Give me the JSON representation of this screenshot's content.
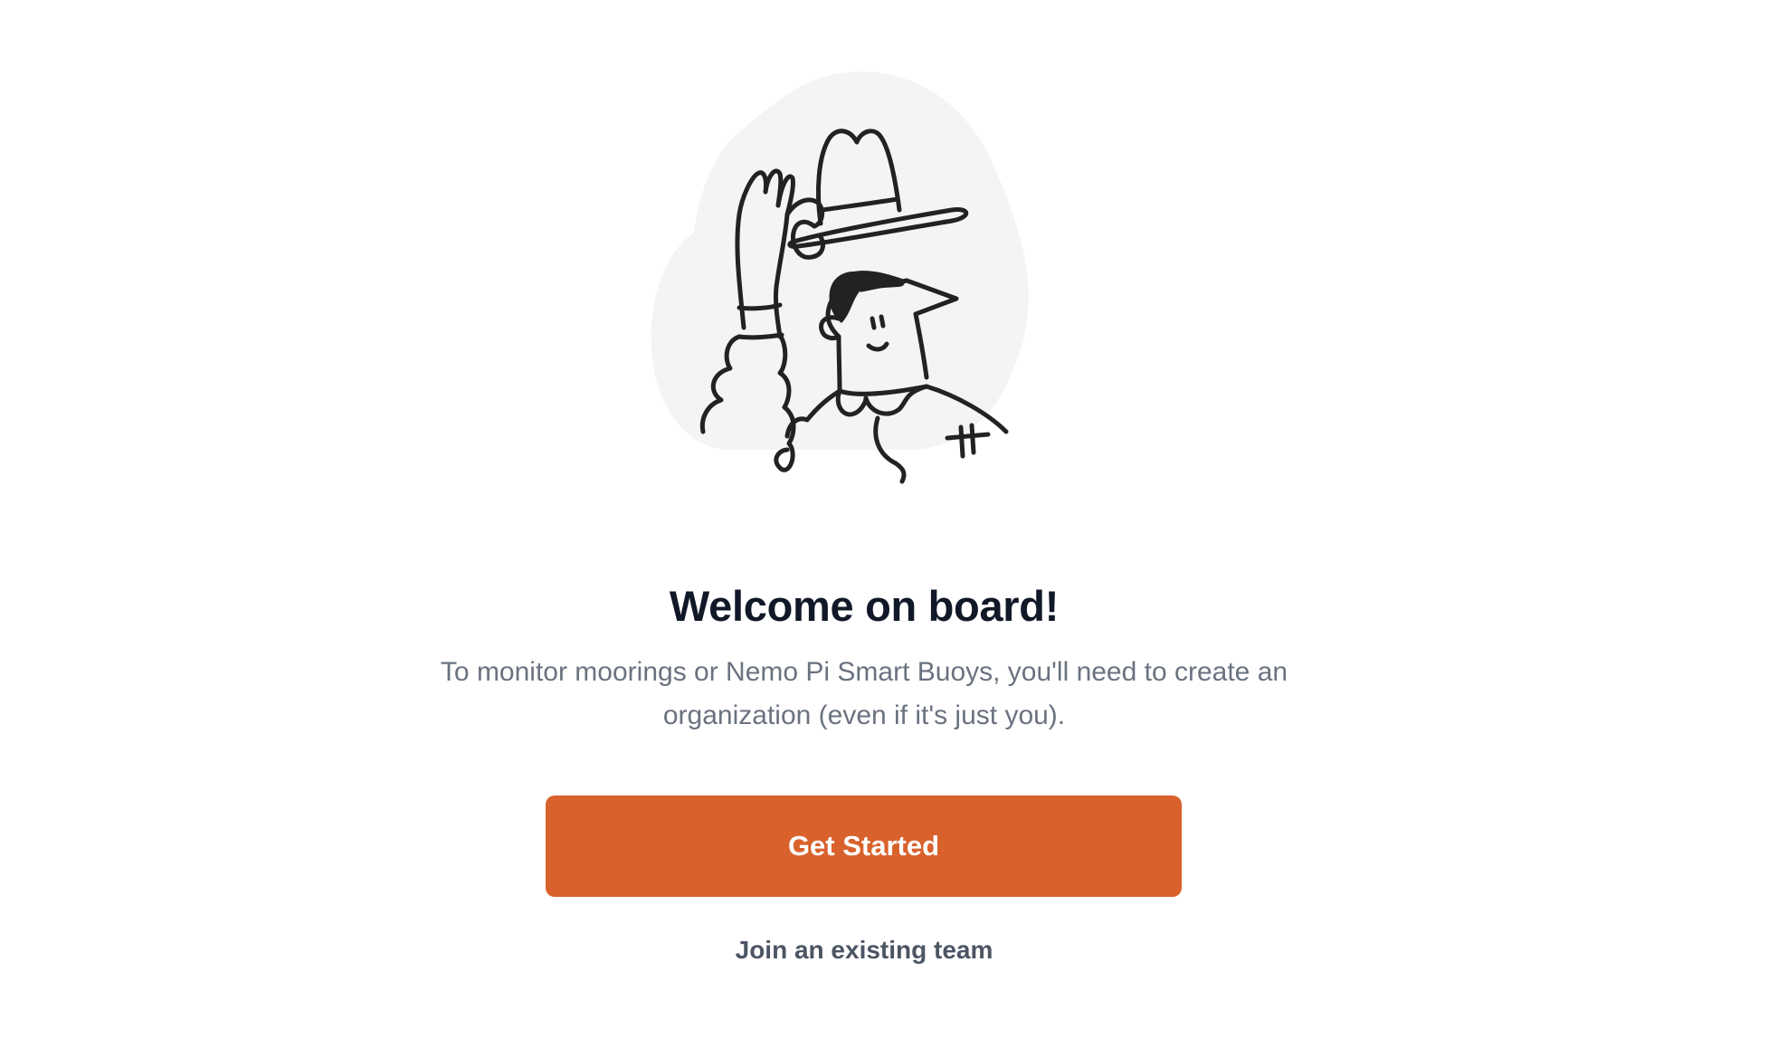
{
  "welcome": {
    "illustration": "person-tipping-hat-illustration",
    "title": "Welcome on board!",
    "description": "To monitor moorings or Nemo Pi Smart Buoys, you'll need to create an organization (even if it's just you).",
    "primary_action_label": "Get Started",
    "secondary_action_label": "Join an existing team"
  },
  "colors": {
    "primary_button": "#d9612c",
    "title_text": "#111827",
    "body_text": "#6b7280",
    "link_text": "#4b5563",
    "illustration_backdrop": "#f3f4f6"
  }
}
